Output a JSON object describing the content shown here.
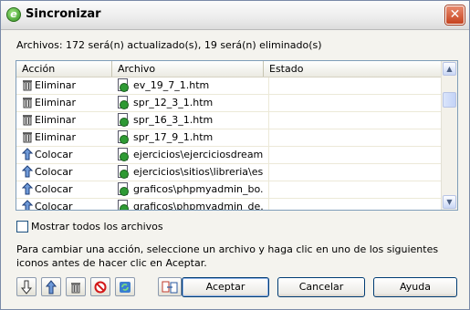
{
  "window": {
    "title": "Sincronizar",
    "close_glyph": "✕"
  },
  "summary": "Archivos:  172 será(n) actualizado(s), 19 será(n) eliminado(s)",
  "table": {
    "columns": [
      "Acción",
      "Archivo",
      "Estado"
    ],
    "rows": [
      {
        "action": "Eliminar",
        "icon": "trash-icon",
        "file": "ev_19_7_1.htm",
        "state": ""
      },
      {
        "action": "Eliminar",
        "icon": "trash-icon",
        "file": "spr_12_3_1.htm",
        "state": ""
      },
      {
        "action": "Eliminar",
        "icon": "trash-icon",
        "file": "spr_16_3_1.htm",
        "state": ""
      },
      {
        "action": "Eliminar",
        "icon": "trash-icon",
        "file": "spr_17_9_1.htm",
        "state": ""
      },
      {
        "action": "Colocar",
        "icon": "put-up-arrow-icon",
        "file": "ejercicios\\ejerciciosdream...",
        "state": ""
      },
      {
        "action": "Colocar",
        "icon": "put-up-arrow-icon",
        "file": "ejercicios\\sitios\\libreria\\es...",
        "state": ""
      },
      {
        "action": "Colocar",
        "icon": "put-up-arrow-icon",
        "file": "graficos\\phpmyadmin_bo...",
        "state": ""
      },
      {
        "action": "Colocar",
        "icon": "put-up-arrow-icon",
        "file": "graficos\\phpmyadmin_de...",
        "state": ""
      }
    ]
  },
  "show_all": {
    "label": "Mostrar todos los archivos",
    "checked": false
  },
  "instructions": "Para cambiar una acción, seleccione un archivo y haga clic en uno de los siguientes iconos antes de hacer clic en Aceptar.",
  "tool_icons": [
    "get-down-arrow-icon",
    "put-up-arrow-icon",
    "trash-icon",
    "ignore-icon",
    "synchronized-icon",
    "compare-icon"
  ],
  "buttons": {
    "accept": "Aceptar",
    "cancel": "Cancelar",
    "help": "Ayuda"
  },
  "colors": {
    "accent_border": "#003c74",
    "list_border": "#7f9db9",
    "close_button": "#c6431f"
  }
}
